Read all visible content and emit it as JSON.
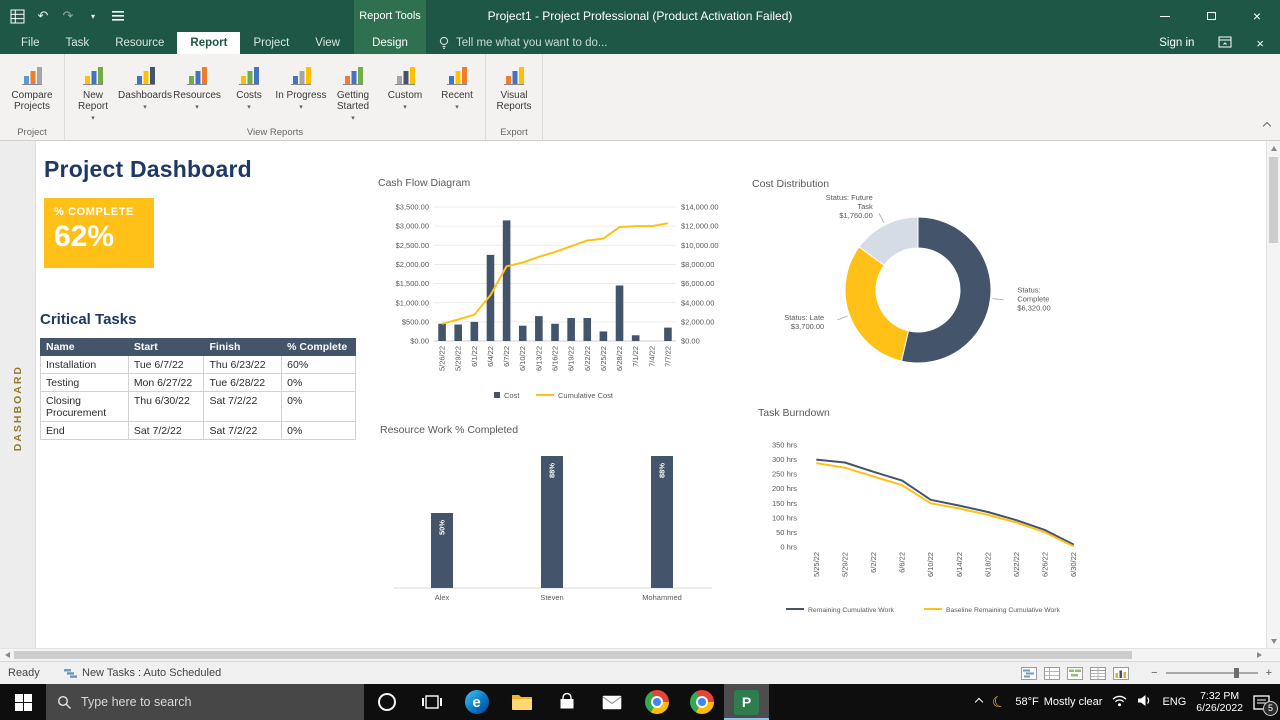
{
  "colors": {
    "title_green": "#1E5745",
    "context_green": "#2F7050",
    "accent_yellow": "#FFC117",
    "slate": "#44546A",
    "navy": "#1F3864"
  },
  "titlebar": {
    "context_group": "Report Tools",
    "title": "Project1 - Project Professional (Product Activation Failed)"
  },
  "ribbon_tabs": {
    "items": [
      "File",
      "Task",
      "Resource",
      "Report",
      "Project",
      "View"
    ],
    "selected": "Report",
    "context_tab": "Design",
    "tell_me": "Tell me what you want to do...",
    "sign_in": "Sign in"
  },
  "ribbon": {
    "groups": [
      {
        "label": "Project",
        "buttons": [
          {
            "label": "Compare Projects",
            "dropdown": false
          }
        ]
      },
      {
        "label": "View Reports",
        "buttons": [
          {
            "label": "New Report",
            "dropdown": true
          },
          {
            "label": "Dashboards",
            "dropdown": true
          },
          {
            "label": "Resources",
            "dropdown": true
          },
          {
            "label": "Costs",
            "dropdown": true
          },
          {
            "label": "In Progress",
            "dropdown": true
          },
          {
            "label": "Getting Started",
            "dropdown": true
          },
          {
            "label": "Custom",
            "dropdown": true
          },
          {
            "label": "Recent",
            "dropdown": true
          }
        ]
      },
      {
        "label": "Export",
        "buttons": [
          {
            "label": "Visual Reports",
            "dropdown": false
          }
        ]
      }
    ]
  },
  "view_strip_label": "DASHBOARD",
  "dashboard": {
    "title": "Project Dashboard",
    "complete_label": "% COMPLETE",
    "complete_value": "62%",
    "critical_tasks_heading": "Critical Tasks",
    "table": {
      "columns": [
        "Name",
        "Start",
        "Finish",
        "% Complete"
      ],
      "rows": [
        [
          "Installation",
          "Tue 6/7/22",
          "Thu 6/23/22",
          "60%"
        ],
        [
          "Testing",
          "Mon 6/27/22",
          "Tue 6/28/22",
          "0%"
        ],
        [
          "Closing Procurement",
          "Thu 6/30/22",
          "Sat 7/2/22",
          "0%"
        ],
        [
          "End",
          "Sat 7/2/22",
          "Sat 7/2/22",
          "0%"
        ]
      ]
    }
  },
  "chart_data": [
    {
      "id": "cash_flow",
      "type": "bar+line",
      "title": "Cash Flow Diagram",
      "categories": [
        "5/26/22",
        "5/29/22",
        "6/1/22",
        "6/4/22",
        "6/7/22",
        "6/10/22",
        "6/13/22",
        "6/16/22",
        "6/19/22",
        "6/22/22",
        "6/25/22",
        "6/28/22",
        "7/1/22",
        "7/4/22",
        "7/7/22"
      ],
      "series": [
        {
          "name": "Cost",
          "type": "bar",
          "axis": "left",
          "color": "#44546A",
          "values": [
            450,
            430,
            500,
            2250,
            3150,
            400,
            650,
            450,
            600,
            600,
            250,
            1450,
            150,
            0,
            350
          ]
        },
        {
          "name": "Cumulative Cost",
          "type": "line",
          "axis": "right",
          "color": "#FFC117",
          "values": [
            1800,
            2250,
            2750,
            4800,
            7800,
            8200,
            8800,
            9300,
            9900,
            10500,
            10700,
            11900,
            12000,
            12000,
            12300
          ]
        }
      ],
      "left_axis": {
        "min": 0,
        "max": 3500,
        "step": 500
      },
      "right_axis": {
        "min": 0,
        "max": 14000,
        "step": 2000
      },
      "legend_position": "bottom"
    },
    {
      "id": "cost_distribution",
      "type": "pie",
      "donut": true,
      "title": "Cost Distribution",
      "slices": [
        {
          "name": "Status: Complete",
          "value": 6320,
          "display": "$6,320.00",
          "color": "#44546A",
          "label_lines": [
            "Status:",
            "Complete",
            "$6,320.00"
          ]
        },
        {
          "name": "Status: Late",
          "value": 3700,
          "display": "$3,700.00",
          "color": "#FFC117",
          "label_lines": [
            "Status: Late",
            "$3,700.00"
          ]
        },
        {
          "name": "Status: Future Task",
          "value": 1760,
          "display": "$1,760.00",
          "color": "#D6DCE5",
          "label_lines": [
            "Status: Future",
            "Task",
            "$1,760.00"
          ]
        }
      ]
    },
    {
      "id": "resource_work",
      "type": "bar",
      "title": "Resource Work % Completed",
      "categories": [
        "Alex",
        "Steven",
        "Mohammed"
      ],
      "values": [
        50,
        88,
        88
      ],
      "bar_labels": [
        "50%",
        "88%",
        "88%"
      ],
      "bar_color": "#44546A",
      "ylim": [
        0,
        100
      ]
    },
    {
      "id": "task_burndown",
      "type": "line",
      "title": "Task Burndown",
      "categories": [
        "5/25/22",
        "5/29/22",
        "6/2/22",
        "6/6/22",
        "6/10/22",
        "6/14/22",
        "6/18/22",
        "6/22/22",
        "6/26/22",
        "6/30/22"
      ],
      "series": [
        {
          "name": "Remaining Cumulative Work",
          "color": "#44546A",
          "values": [
            300,
            290,
            258,
            228,
            162,
            142,
            120,
            92,
            58,
            8
          ]
        },
        {
          "name": "Baseline Remaining Cumulative Work",
          "color": "#FFC117",
          "values": [
            288,
            272,
            242,
            212,
            150,
            132,
            110,
            84,
            50,
            2
          ]
        }
      ],
      "y_axis": {
        "min": 0,
        "max": 350,
        "step": 50,
        "suffix": " hrs"
      },
      "legend_position": "bottom"
    }
  ],
  "statusbar": {
    "ready": "Ready",
    "new_tasks": "New Tasks : Auto Scheduled"
  },
  "taskbar": {
    "search_placeholder": "Type here to search",
    "weather_temp": "58°F",
    "weather_desc": "Mostly clear",
    "language": "ENG",
    "time": "7:32 PM",
    "date": "6/26/2022",
    "notification_count": "5"
  }
}
